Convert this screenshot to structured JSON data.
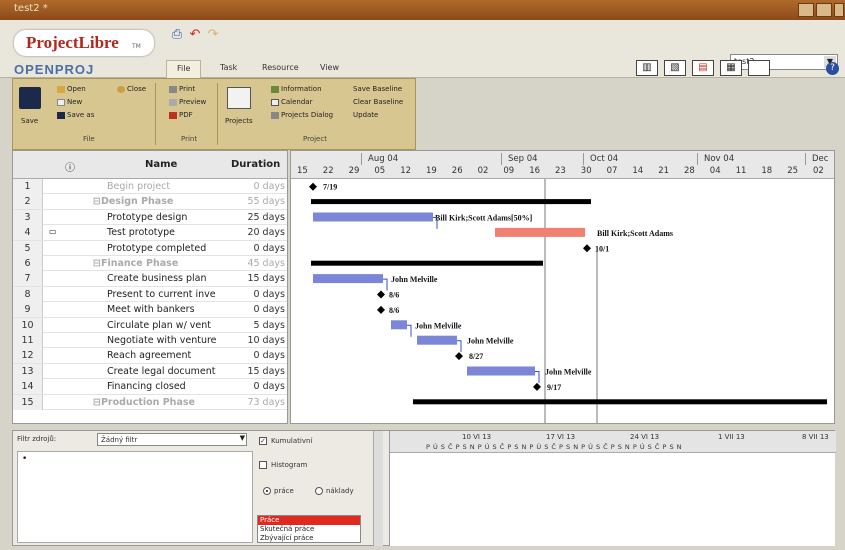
{
  "window": {
    "title": "test2 *"
  },
  "app": {
    "logo": "ProjectLibre",
    "logo_tm": "TM",
    "brand2": "OPENPROJ"
  },
  "tabs": [
    "File",
    "Task",
    "Resource",
    "View"
  ],
  "project_select": {
    "value": "test2"
  },
  "ribbon": {
    "file": {
      "label": "File",
      "save": "Save",
      "open": "Open",
      "new": "New",
      "save_as": "Save as",
      "close": "Close"
    },
    "print": {
      "label": "Print",
      "print": "Print",
      "preview": "Preview",
      "pdf": "PDF"
    },
    "project": {
      "label": "Project",
      "projects": "Projects",
      "information": "Information",
      "calendar": "Calendar",
      "projects_dialog": "Projects Dialog",
      "save_baseline": "Save Baseline",
      "clear_baseline": "Clear Baseline",
      "update": "Update"
    }
  },
  "table": {
    "headers": {
      "info": "ⓘ",
      "name": "Name",
      "duration": "Duration"
    },
    "rows": [
      {
        "num": "1",
        "name": "Begin project",
        "duration": "0 days",
        "summary": false,
        "indent": 1,
        "faded": true
      },
      {
        "num": "2",
        "name": "⊟Design Phase",
        "duration": "55 days",
        "summary": true,
        "indent": 0,
        "faded": true
      },
      {
        "num": "3",
        "name": "Prototype design",
        "duration": "25 days",
        "summary": false,
        "indent": 1,
        "faded": false
      },
      {
        "num": "4",
        "name": "Test prototype",
        "duration": "20 days",
        "summary": false,
        "indent": 1,
        "faded": false,
        "icon": "note"
      },
      {
        "num": "5",
        "name": "Prototype completed",
        "duration": "0 days",
        "summary": false,
        "indent": 1,
        "faded": false
      },
      {
        "num": "6",
        "name": "⊟Finance Phase",
        "duration": "45 days",
        "summary": true,
        "indent": 0,
        "faded": true
      },
      {
        "num": "7",
        "name": "Create business plan",
        "duration": "15 days",
        "summary": false,
        "indent": 1,
        "faded": false
      },
      {
        "num": "8",
        "name": "Present to current inve",
        "duration": "0 days",
        "summary": false,
        "indent": 1,
        "faded": false
      },
      {
        "num": "9",
        "name": "Meet with bankers",
        "duration": "0 days",
        "summary": false,
        "indent": 1,
        "faded": false
      },
      {
        "num": "10",
        "name": "Circulate plan w/ vent",
        "duration": "5 days",
        "summary": false,
        "indent": 1,
        "faded": false
      },
      {
        "num": "11",
        "name": "Negotiate with venture",
        "duration": "10 days",
        "summary": false,
        "indent": 1,
        "faded": false
      },
      {
        "num": "12",
        "name": "Reach agreement",
        "duration": "0 days",
        "summary": false,
        "indent": 1,
        "faded": false
      },
      {
        "num": "13",
        "name": "Create legal document",
        "duration": "15 days",
        "summary": false,
        "indent": 1,
        "faded": false
      },
      {
        "num": "14",
        "name": "Financing closed",
        "duration": "0 days",
        "summary": false,
        "indent": 1,
        "faded": false
      },
      {
        "num": "15",
        "name": "⊟Production Phase",
        "duration": "73 days",
        "summary": true,
        "indent": 0,
        "faded": true
      }
    ]
  },
  "gantt": {
    "months": [
      "Aug 04",
      "Sep 04",
      "Oct 04",
      "Nov 04",
      "Dec"
    ],
    "days": [
      "15",
      "22",
      "29",
      "05",
      "12",
      "19",
      "26",
      "02",
      "09",
      "16",
      "23",
      "30",
      "07",
      "14",
      "21",
      "28",
      "04",
      "11",
      "18",
      "25",
      "02"
    ],
    "labels": {
      "begin": "7/19",
      "test": "Bill Kirk;Scott Adams[50%]",
      "proto_completed_res": "Bill Kirk;Scott Adams",
      "proto_completed_date": "10/1",
      "biz_plan": "John Melville",
      "present": "8/6",
      "meet": "8/6",
      "circulate": "John Melville",
      "negotiate": "John Melville",
      "reach": "8/27",
      "legal": "John Melville",
      "closed": "9/17"
    },
    "colors": {
      "bar": "#7b86d6",
      "critical": "#f08070",
      "summary": "#000000"
    }
  },
  "bottom": {
    "filter_label": "Filtr zdrojů:",
    "filter_value": "Žádný filtr",
    "kumulativni": "Kumulativní",
    "histogram": "Histogram",
    "prace": "práce",
    "naklady": "náklady",
    "list": [
      "Práce",
      "Skutečná práce",
      "Zbývající práce"
    ],
    "timeline_top": [
      "10 VI 13",
      "17 VI 13",
      "24 VI 13",
      "1 VII 13",
      "8 VII 13"
    ],
    "timeline_days": "P Ú S Č P S N P Ú S Č P S N P Ú S Č P S N P Ú S Č P S N P Ú S Č P S N"
  }
}
